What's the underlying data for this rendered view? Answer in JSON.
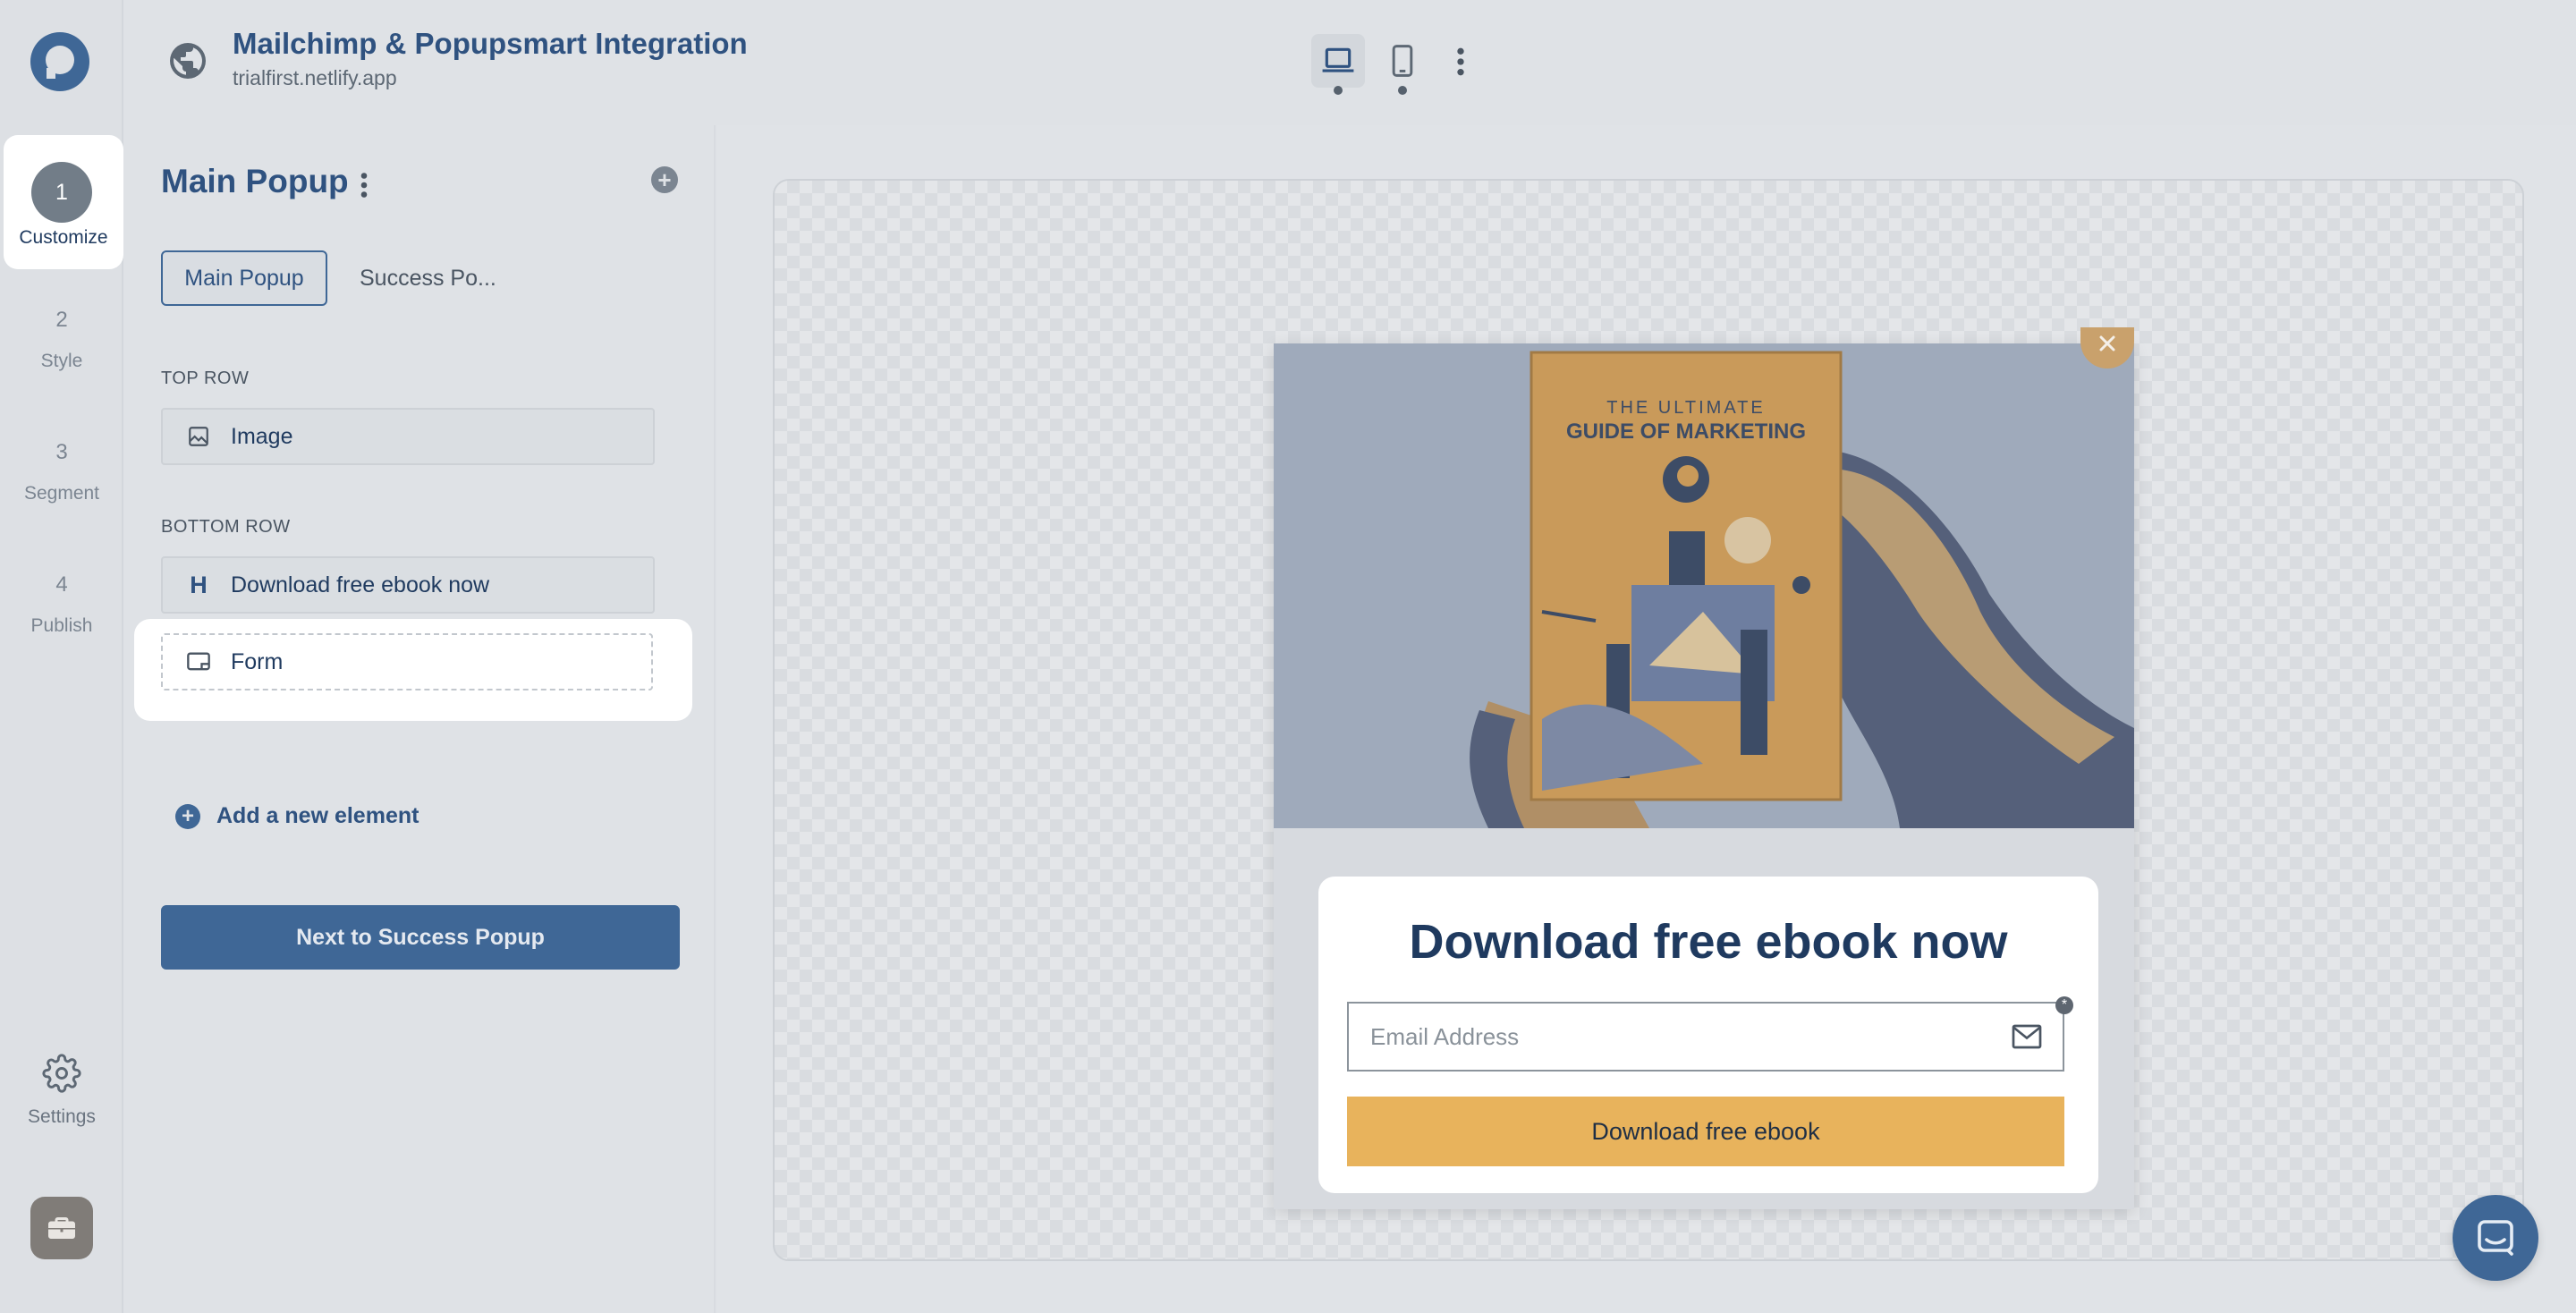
{
  "header": {
    "site_title": "Mailchimp & Popupsmart Integration",
    "site_url": "trialfirst.netlify.app"
  },
  "nav": {
    "steps": [
      {
        "num": "1",
        "label": "Customize",
        "active": true
      },
      {
        "num": "2",
        "label": "Style"
      },
      {
        "num": "3",
        "label": "Segment"
      },
      {
        "num": "4",
        "label": "Publish"
      }
    ],
    "settings_label": "Settings"
  },
  "panel": {
    "title": "Main Popup",
    "tabs": [
      {
        "label": "Main Popup",
        "active": true
      },
      {
        "label": "Success Po..."
      }
    ],
    "top_row_label": "TOP ROW",
    "top_row_items": [
      {
        "label": "Image",
        "icon": "image-icon"
      }
    ],
    "bottom_row_label": "BOTTOM ROW",
    "bottom_row_items": [
      {
        "label": "Download free ebook now",
        "icon": "heading-icon"
      },
      {
        "label": "Form",
        "icon": "form-icon"
      }
    ],
    "add_element_label": "Add a new element",
    "next_button_label": "Next to Success Popup"
  },
  "popup": {
    "book_line1": "THE ULTIMATE",
    "book_line2": "GUIDE OF MARKETING",
    "headline": "Download free ebook now",
    "email_placeholder": "Email Address",
    "required_mark": "*",
    "button_label": "Download free ebook"
  },
  "colors": {
    "brand": "#3f6796",
    "cta": "#e8b35c",
    "book": "#c9a16c"
  }
}
